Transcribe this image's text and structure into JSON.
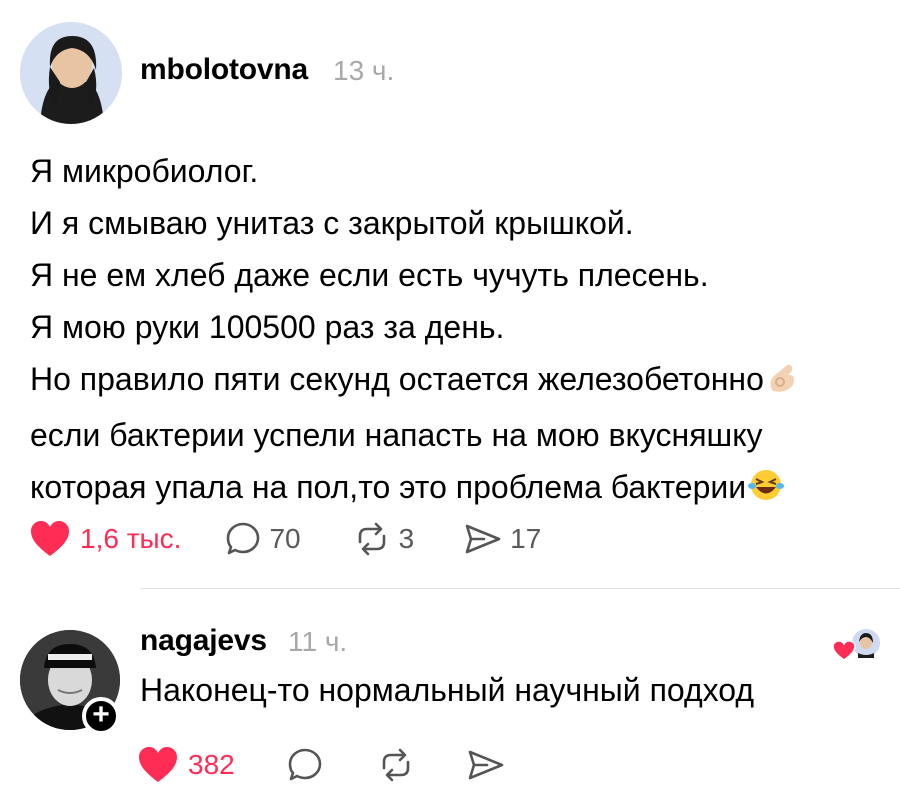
{
  "post": {
    "username": "mbolotovna",
    "time": "13 ч.",
    "lines": [
      "Я микробиолог.",
      "И я смываю унитаз с закрытой крышкой.",
      "Я не ем хлеб даже если есть чучуть плесень.",
      "Я мою руки 100500 раз за день.",
      "Но правило пяти секунд остается железобетонно",
      "если бактерии успели напасть на мою вкусняшку",
      "которая упала на пол,то это проблема бактерии"
    ],
    "likes": "1,6 тыс.",
    "comments": "70",
    "reposts": "3",
    "shares": "17"
  },
  "reply": {
    "username": "nagajevs",
    "time": "11 ч.",
    "text": "Наконец-то нормальный научный подход",
    "likes": "382"
  },
  "colors": {
    "like": "#ff2c55",
    "time": "#a8a8a8",
    "icon": "#5a5a5a",
    "divider": "#e3e3e3"
  },
  "icons": [
    "heart-icon",
    "comment-icon",
    "repost-icon",
    "share-icon",
    "ok-hand-emoji",
    "laughing-emoji",
    "plus-icon"
  ]
}
